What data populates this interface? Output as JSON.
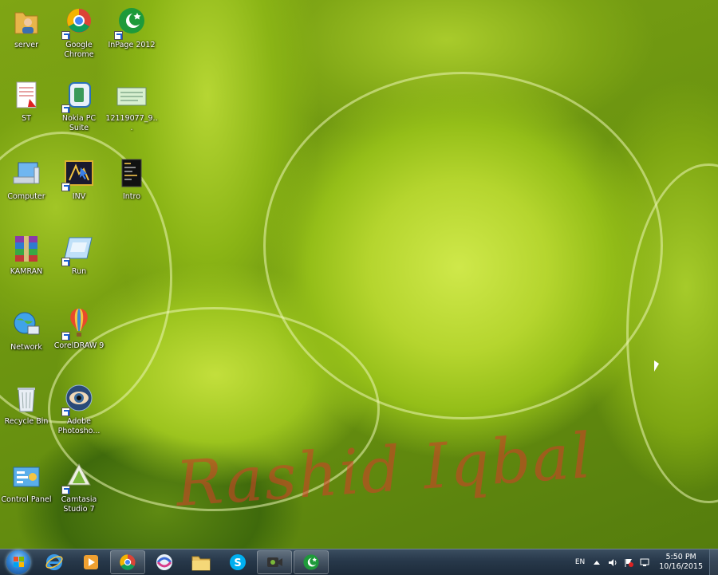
{
  "desktop": {
    "icons": [
      {
        "id": "server",
        "label": "server",
        "icon": "folder-user-icon"
      },
      {
        "id": "chrome",
        "label": "Google Chrome",
        "icon": "chrome-icon"
      },
      {
        "id": "inpage",
        "label": "InPage 2012",
        "icon": "inpage-icon"
      },
      {
        "id": "st",
        "label": "ST",
        "icon": "pdf-document-icon"
      },
      {
        "id": "nokia",
        "label": "Nokia PC Suite",
        "icon": "nokia-pc-suite-icon"
      },
      {
        "id": "image-file",
        "label": "12119077_9...",
        "icon": "image-file-icon"
      },
      {
        "id": "computer",
        "label": "Computer",
        "icon": "computer-icon"
      },
      {
        "id": "inv",
        "label": "INV",
        "icon": "inv-app-icon"
      },
      {
        "id": "intro",
        "label": "Intro",
        "icon": "video-file-icon"
      },
      {
        "id": "kamran",
        "label": "KAMRAN",
        "icon": "winrar-archive-icon"
      },
      {
        "id": "run",
        "label": "Run",
        "icon": "run-icon"
      },
      {
        "id": "network",
        "label": "Network",
        "icon": "network-globe-icon"
      },
      {
        "id": "coreldraw",
        "label": "CorelDRAW 9",
        "icon": "coreldraw-balloon-icon"
      },
      {
        "id": "recycle",
        "label": "Recycle Bin",
        "icon": "recycle-bin-icon"
      },
      {
        "id": "photoshop",
        "label": "Adobe Photosho...",
        "icon": "photoshop-eye-icon"
      },
      {
        "id": "control-panel",
        "label": "Control Panel",
        "icon": "control-panel-icon"
      },
      {
        "id": "camtasia",
        "label": "Camtasia Studio 7",
        "icon": "camtasia-icon"
      }
    ],
    "watermark": "Rashid Iqbal"
  },
  "taskbar": {
    "pinned": [
      {
        "id": "ie",
        "icon": "internet-explorer-icon",
        "active": false
      },
      {
        "id": "media-player",
        "icon": "media-player-icon",
        "active": false
      },
      {
        "id": "chrome",
        "icon": "chrome-icon",
        "active": true
      },
      {
        "id": "swirl-app",
        "icon": "swirl-app-icon",
        "active": false
      },
      {
        "id": "explorer",
        "icon": "file-explorer-icon",
        "active": false
      },
      {
        "id": "skype",
        "icon": "skype-icon",
        "active": false
      },
      {
        "id": "camtasia-recorder",
        "icon": "camtasia-recorder-icon",
        "active": true
      },
      {
        "id": "inpage",
        "icon": "inpage-icon",
        "active": true
      }
    ],
    "tray": {
      "language": "EN",
      "time": "5:50 PM",
      "date": "10/16/2015"
    }
  },
  "colors": {
    "taskbar_top": "#3b4e60",
    "taskbar_bottom": "#1d2b3a",
    "watermark": "#d63c28",
    "wallpaper_main": "#b5d52e"
  }
}
